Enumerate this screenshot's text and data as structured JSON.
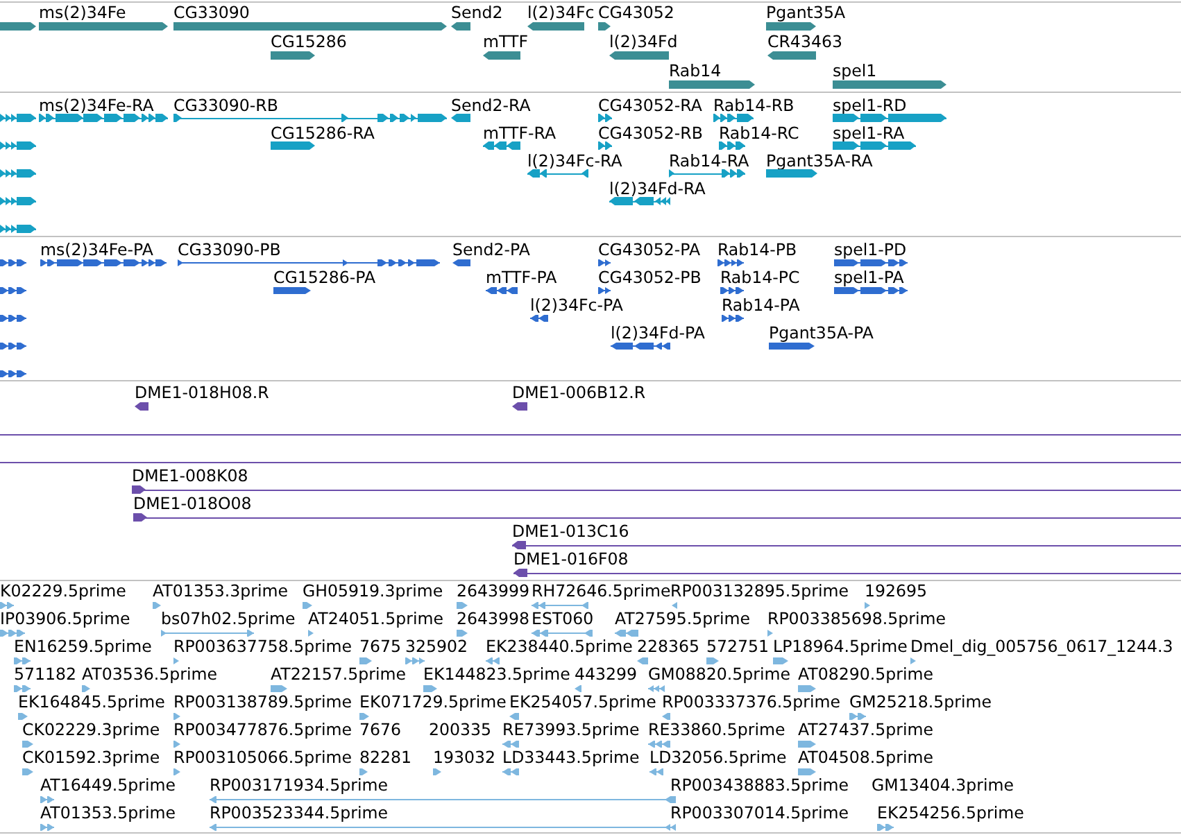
{
  "tracks": [
    {
      "kind": "gene",
      "rows": [
        {
          "features": [
            {
              "reverse": false
            },
            {
              "label": "ms(2)34Fe",
              "reverse": false
            },
            {
              "label": "CG33090",
              "reverse": false
            },
            {
              "label": "Send2",
              "reverse": true
            },
            {
              "label": "l(2)34Fc",
              "reverse": true
            },
            {
              "label": "CG43052",
              "reverse": false
            },
            {
              "label": "Pgant35A",
              "reverse": false
            }
          ]
        },
        {
          "features": [
            {
              "label": "CG15286",
              "reverse": false
            },
            {
              "label": "mTTF",
              "reverse": true
            },
            {
              "label": "l(2)34Fd",
              "reverse": true
            },
            {
              "label": "CR43463",
              "reverse": true
            }
          ]
        },
        {
          "features": [
            {
              "label": "Rab14",
              "reverse": false
            },
            {
              "label": "spel1",
              "reverse": false
            }
          ]
        }
      ]
    },
    {
      "kind": "transcript",
      "rows": [
        {
          "features": [
            {
              "reverse": false
            },
            {
              "label": "ms(2)34Fe-RA",
              "reverse": false
            },
            {
              "label": "CG33090-RB",
              "reverse": false
            },
            {
              "label": "Send2-RA",
              "reverse": true
            },
            {
              "label": "CG43052-RA",
              "reverse": false
            },
            {
              "label": "Rab14-RB",
              "reverse": false
            },
            {
              "label": "spel1-RD",
              "reverse": false
            }
          ]
        },
        {
          "features": [
            {
              "reverse": false
            },
            {
              "label": "CG15286-RA",
              "reverse": false
            },
            {
              "label": "mTTF-RA",
              "reverse": true
            },
            {
              "label": "CG43052-RB",
              "reverse": false
            },
            {
              "label": "Rab14-RC",
              "reverse": false
            },
            {
              "label": "spel1-RA",
              "reverse": false
            }
          ]
        },
        {
          "features": [
            {
              "reverse": false
            },
            {
              "label": "l(2)34Fc-RA",
              "reverse": true
            },
            {
              "label": "Rab14-RA",
              "reverse": false
            },
            {
              "label": "Pgant35A-RA",
              "reverse": false
            }
          ]
        },
        {
          "features": [
            {
              "reverse": false
            },
            {
              "label": "l(2)34Fd-RA",
              "reverse": true
            }
          ]
        },
        {
          "features": [
            {
              "reverse": false
            }
          ]
        }
      ]
    },
    {
      "kind": "protein",
      "rows": [
        {
          "features": [
            {
              "reverse": false
            },
            {
              "label": "ms(2)34Fe-PA",
              "reverse": false
            },
            {
              "label": "CG33090-PB",
              "reverse": false
            },
            {
              "label": "Send2-PA",
              "reverse": true
            },
            {
              "label": "CG43052-PA",
              "reverse": false
            },
            {
              "label": "Rab14-PB",
              "reverse": false
            },
            {
              "label": "spel1-PD",
              "reverse": false
            }
          ]
        },
        {
          "features": [
            {
              "reverse": false
            },
            {
              "label": "CG15286-PA",
              "reverse": false
            },
            {
              "label": "mTTF-PA",
              "reverse": true
            },
            {
              "label": "CG43052-PB",
              "reverse": false
            },
            {
              "label": "Rab14-PC",
              "reverse": false
            },
            {
              "label": "spel1-PA",
              "reverse": false
            }
          ]
        },
        {
          "features": [
            {
              "reverse": false
            },
            {
              "label": "l(2)34Fc-PA",
              "reverse": true
            },
            {
              "label": "Rab14-PA",
              "reverse": false
            }
          ]
        },
        {
          "features": [
            {
              "reverse": false
            },
            {
              "label": "l(2)34Fd-PA",
              "reverse": true
            },
            {
              "label": "Pgant35A-PA",
              "reverse": false
            }
          ]
        },
        {
          "features": [
            {
              "reverse": false
            }
          ]
        }
      ]
    },
    {
      "kind": "clone",
      "rows": [
        {
          "features": [
            {
              "kind": "arrow",
              "label": "DME1-018H08.R",
              "reverse": true
            },
            {
              "kind": "arrow",
              "label": "DME1-006B12.R",
              "reverse": true
            }
          ]
        },
        {
          "features": [
            {
              "kind": "line"
            }
          ]
        },
        {
          "features": [
            {
              "kind": "line"
            }
          ]
        },
        {
          "features": [
            {
              "kind": "arrow",
              "label": "DME1-008K08",
              "reverse": false
            }
          ]
        },
        {
          "features": [
            {
              "kind": "arrow",
              "label": "DME1-018O08",
              "reverse": false
            }
          ]
        },
        {
          "features": [
            {
              "kind": "arrow",
              "label": "DME1-013C16",
              "reverse": true
            }
          ]
        },
        {
          "features": [
            {
              "kind": "arrow",
              "label": "DME1-016F08",
              "reverse": true
            }
          ]
        }
      ]
    },
    {
      "kind": "est",
      "rows": [
        {
          "features": [
            {
              "label": "K02229.5prime",
              "reverse": false
            },
            {
              "label": "AT01353.3prime",
              "reverse": false
            },
            {
              "label": "GH05919.3prime",
              "reverse": false
            },
            {
              "label": "2643999",
              "reverse": false
            },
            {
              "label": "RH72646.5prime",
              "reverse": true
            },
            {
              "label": "RP003132895.5prime",
              "reverse": true
            },
            {
              "label": "192695",
              "reverse": false
            }
          ]
        },
        {
          "features": [
            {
              "label": "IP03906.5prime",
              "reverse": false
            },
            {
              "label": "bs07h02.5prime",
              "reverse": false
            },
            {
              "label": "AT24051.5prime",
              "reverse": false
            },
            {
              "label": "2643998",
              "reverse": false
            },
            {
              "label": "EST060",
              "reverse": true
            },
            {
              "label": "AT27595.5prime",
              "reverse": true
            },
            {
              "label": "RP003385698.5prime",
              "reverse": false
            }
          ]
        },
        {
          "features": [
            {
              "label": "EN16259.5prime",
              "reverse": false
            },
            {
              "label": "RP003637758.5prime",
              "reverse": false
            },
            {
              "label": "7675",
              "reverse": false
            },
            {
              "label": "325902",
              "reverse": false
            },
            {
              "label": "EK238440.5prime",
              "reverse": true
            },
            {
              "label": "228365",
              "reverse": true
            },
            {
              "label": "572751",
              "reverse": false
            },
            {
              "label": "LP18964.5prime",
              "reverse": false
            },
            {
              "label": "Dmel_dig_005756_0617_1244.3",
              "reverse": false
            }
          ]
        },
        {
          "features": [
            {
              "label": "571182",
              "reverse": false
            },
            {
              "label": "AT03536.5prime",
              "reverse": false
            },
            {
              "label": "AT22157.5prime",
              "reverse": false
            },
            {
              "label": "EK144823.5prime",
              "reverse": false
            },
            {
              "label": "443299",
              "reverse": true
            },
            {
              "label": "GM08820.5prime",
              "reverse": true
            },
            {
              "label": "AT08290.5prime",
              "reverse": false
            }
          ]
        },
        {
          "features": [
            {
              "label": "EK164845.5prime",
              "reverse": false
            },
            {
              "label": "RP003138789.5prime",
              "reverse": false
            },
            {
              "label": "EK071729.5prime",
              "reverse": false
            },
            {
              "label": "EK254057.5prime",
              "reverse": true
            },
            {
              "label": "RP003337376.5prime",
              "reverse": true
            },
            {
              "label": "GM25218.5prime",
              "reverse": false
            }
          ]
        },
        {
          "features": [
            {
              "label": "CK02229.3prime",
              "reverse": false
            },
            {
              "label": "RP003477876.5prime",
              "reverse": false
            },
            {
              "label": "7676"
            },
            {
              "label": "200335"
            },
            {
              "label": "RE73993.5prime",
              "reverse": true
            },
            {
              "label": "RE33860.5prime",
              "reverse": true
            },
            {
              "label": "AT27437.5prime",
              "reverse": false
            }
          ]
        },
        {
          "features": [
            {
              "label": "CK01592.3prime",
              "reverse": false
            },
            {
              "label": "RP003105066.5prime",
              "reverse": false
            },
            {
              "label": "82281",
              "reverse": false
            },
            {
              "label": "193032",
              "reverse": false
            },
            {
              "label": "LD33443.5prime",
              "reverse": true
            },
            {
              "label": "LD32056.5prime",
              "reverse": true
            },
            {
              "label": "AT04508.5prime",
              "reverse": false
            }
          ]
        },
        {
          "features": [
            {
              "label": "AT16449.5prime",
              "reverse": false
            },
            {
              "label": "RP003171934.5prime",
              "reverse": true
            },
            {
              "label": "RP003438883.5prime"
            },
            {
              "label": "GM13404.3prime"
            }
          ]
        },
        {
          "features": [
            {
              "label": "AT01353.5prime",
              "reverse": false
            },
            {
              "label": "RP003523344.5prime",
              "reverse": true
            },
            {
              "label": "RP003307014.5prime"
            },
            {
              "label": "EK254256.5prime",
              "reverse": false
            }
          ]
        }
      ]
    }
  ]
}
